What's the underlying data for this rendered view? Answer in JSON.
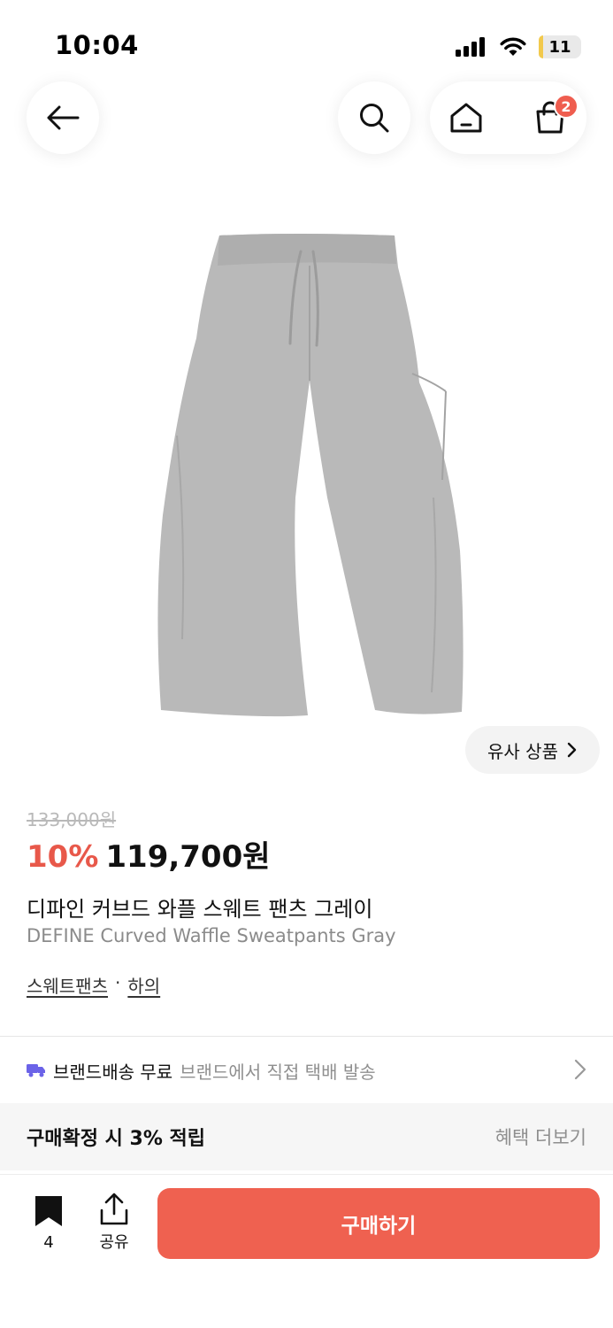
{
  "status": {
    "time": "10:04",
    "battery": "11",
    "battery_level": 0.11
  },
  "header": {
    "cart_count": "2"
  },
  "product": {
    "similar_label": "유사 상품",
    "original_price": "133,000원",
    "discount": "10%",
    "sale_price": "119,700원",
    "name_kr": "디파인 커브드 와플 스웨트 팬츠 그레이",
    "name_en": "DEFINE Curved Waffle Sweatpants Gray",
    "categories": [
      "스웨트팬츠",
      "하의"
    ],
    "category_separator": "·"
  },
  "shipping": {
    "main": "브랜드배송 무료",
    "sub": "브랜드에서 직접 택배 발송"
  },
  "benefit": {
    "main": "구매확정 시 3% 적립",
    "more": "혜택 더보기"
  },
  "bottom": {
    "bookmark_count": "4",
    "share_label": "공유",
    "buy_label": "구매하기"
  },
  "colors": {
    "accent": "#ef6150",
    "discount": "#e8584a",
    "badge": "#ef5d4f",
    "product_gray": "#b9b9b9"
  }
}
